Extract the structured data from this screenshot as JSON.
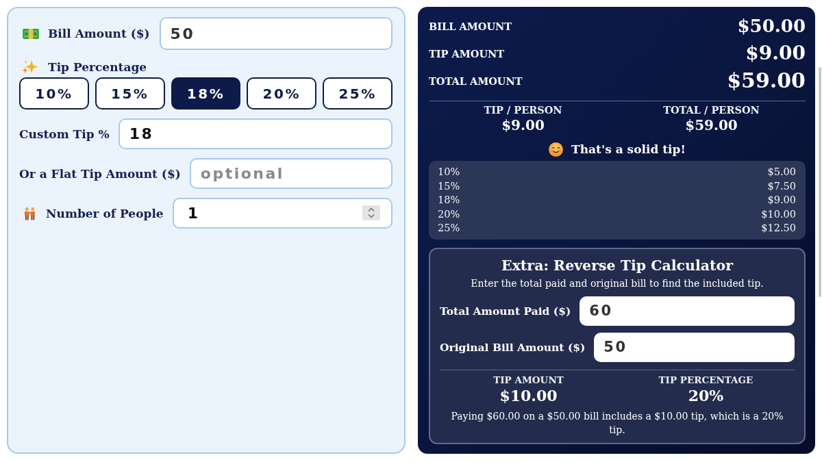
{
  "inputs": {
    "bill": {
      "label": "Bill Amount ($)",
      "value": "50"
    },
    "tip_percentage": {
      "label": "Tip Percentage",
      "options": [
        {
          "label": "10%",
          "selected": false
        },
        {
          "label": "15%",
          "selected": false
        },
        {
          "label": "18%",
          "selected": true
        },
        {
          "label": "20%",
          "selected": false
        },
        {
          "label": "25%",
          "selected": false
        }
      ]
    },
    "custom_tip": {
      "label": "Custom Tip %",
      "value": "18"
    },
    "flat_tip": {
      "label": "Or a Flat Tip Amount ($)",
      "placeholder": "optional"
    },
    "people": {
      "label": "Number of People",
      "value": "1"
    }
  },
  "summary": {
    "rows": [
      {
        "label": "BILL AMOUNT",
        "value": "$50.00"
      },
      {
        "label": "TIP AMOUNT",
        "value": "$9.00"
      },
      {
        "label": "TOTAL AMOUNT",
        "value": "$59.00"
      }
    ],
    "per_person": [
      {
        "label": "TIP / PERSON",
        "value": "$9.00"
      },
      {
        "label": "TOTAL / PERSON",
        "value": "$59.00"
      }
    ],
    "message": "That's a solid tip!",
    "tip_table": [
      {
        "percent": "10%",
        "amount": "$5.00"
      },
      {
        "percent": "15%",
        "amount": "$7.50"
      },
      {
        "percent": "18%",
        "amount": "$9.00"
      },
      {
        "percent": "20%",
        "amount": "$10.00"
      },
      {
        "percent": "25%",
        "amount": "$12.50"
      }
    ]
  },
  "reverse": {
    "title": "Extra: Reverse Tip Calculator",
    "description": "Enter the total paid and original bill to find the included tip.",
    "fields": [
      {
        "label": "Total Amount Paid ($)",
        "value": "60"
      },
      {
        "label": "Original Bill Amount ($)",
        "value": "50"
      }
    ],
    "results": [
      {
        "label": "TIP AMOUNT",
        "value": "$10.00"
      },
      {
        "label": "TIP PERCENTAGE",
        "value": "20%"
      }
    ],
    "summary": "Paying $60.00 on a $50.00 bill includes a $10.00 tip, which is a 20% tip."
  }
}
